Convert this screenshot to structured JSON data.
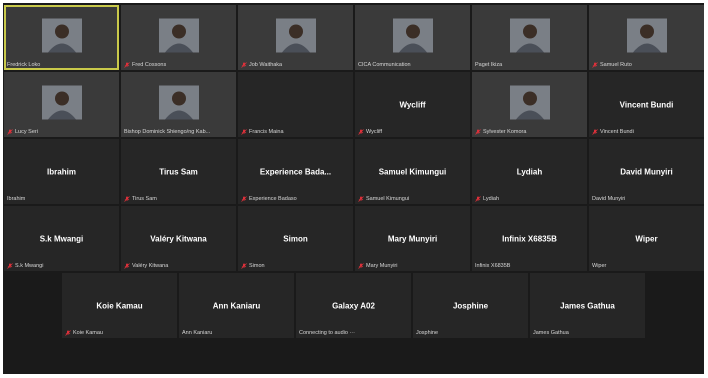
{
  "meeting": {
    "row1": [
      {
        "label": "Fredrick Loko",
        "muted": false,
        "video": true,
        "active": true
      },
      {
        "label": "Fred Cossons",
        "muted": true,
        "video": true
      },
      {
        "label": "Job Waithaka",
        "muted": true,
        "video": true
      },
      {
        "label": "CICA Communication",
        "muted": false,
        "video": true
      },
      {
        "label": "Paget Ikiza",
        "muted": false,
        "video": true
      },
      {
        "label": "Samuel Ruto",
        "muted": true,
        "video": true
      }
    ],
    "row2": [
      {
        "label": "Lucy Seri",
        "muted": true,
        "video": true
      },
      {
        "label": "Bishop Dominick Shiengo/ng Kab...",
        "muted": false,
        "video": true
      },
      {
        "label": "Francis Maina",
        "muted": true,
        "video": false
      },
      {
        "center": "Wycliff",
        "label": "Wycliff",
        "muted": true
      },
      {
        "label": "Sylvester Komora",
        "muted": true,
        "video": true
      },
      {
        "center": "Vincent Bundi",
        "label": "Vincent Bundi",
        "muted": true
      }
    ],
    "row3": [
      {
        "center": "Ibrahim",
        "label": "Ibrahim",
        "muted": false
      },
      {
        "center": "Tirus Sam",
        "label": "Tirus Sam",
        "muted": true
      },
      {
        "center": "Experience Bada...",
        "label": "Experience Badaso",
        "muted": true
      },
      {
        "center": "Samuel Kimungui",
        "label": "Samuel Kimungui",
        "muted": true
      },
      {
        "center": "Lydiah",
        "label": "Lydiah",
        "muted": true
      },
      {
        "center": "David Munyiri",
        "label": "David Munyiri",
        "muted": false
      }
    ],
    "row4": [
      {
        "center": "S.k Mwangi",
        "label": "S.k Mwangi",
        "muted": true
      },
      {
        "center": "Valéry Kitwana",
        "label": "Valéry Kitwana",
        "muted": true
      },
      {
        "center": "Simon",
        "label": "Simon",
        "muted": true
      },
      {
        "center": "Mary Munyiri",
        "label": "Mary Munyiri",
        "muted": true
      },
      {
        "center": "Infinix X6835B",
        "label": "Infinix X6835B",
        "muted": false
      },
      {
        "center": "Wiper",
        "label": "Wiper",
        "muted": false
      }
    ],
    "row5": [
      {
        "center": "Koie Kamau",
        "label": "Koie Kamau",
        "muted": true
      },
      {
        "center": "Ann Kaniaru",
        "label": "Ann Kaniaru",
        "muted": false
      },
      {
        "center": "Galaxy A02",
        "label": "Connecting to audio ···",
        "muted": false
      },
      {
        "center": "Josphine",
        "label": "Josphine",
        "muted": false
      },
      {
        "center": "James Gathua",
        "label": "James Gathua",
        "muted": false
      }
    ]
  },
  "colors": {
    "muted_icon": "#e0303a",
    "active_border": "#c9c94a",
    "tile_bg": "#262626",
    "frame_bg": "#1a1a1a"
  }
}
